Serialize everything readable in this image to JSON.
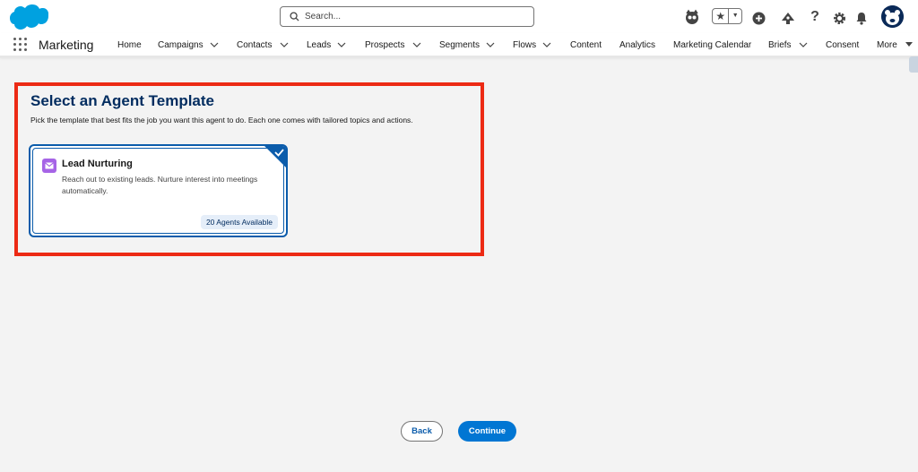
{
  "header": {
    "search_placeholder": "Search...",
    "brand_color": "#00a1e0"
  },
  "nav": {
    "app_name": "Marketing",
    "items": [
      {
        "label": "Home"
      },
      {
        "label": "Campaigns"
      },
      {
        "label": "Contacts"
      },
      {
        "label": "Leads"
      },
      {
        "label": "Prospects"
      },
      {
        "label": "Segments"
      },
      {
        "label": "Flows"
      },
      {
        "label": "Content"
      },
      {
        "label": "Analytics"
      },
      {
        "label": "Marketing Calendar"
      },
      {
        "label": "Briefs"
      },
      {
        "label": "Consent"
      },
      {
        "label": "More"
      }
    ]
  },
  "main": {
    "title": "Select an Agent Template",
    "description": "Pick the template that best fits the job you want this agent to do. Each one comes with tailored topics and actions.",
    "template_card": {
      "icon": "envelope-icon",
      "title": "Lead Nurturing",
      "description": "Reach out to existing leads. Nurture interest into meetings automatically.",
      "badge": "20 Agents Available",
      "selected": true
    }
  },
  "footer": {
    "back_label": "Back",
    "continue_label": "Continue"
  },
  "colors": {
    "highlight_border": "#ec2a14",
    "title": "#032d60",
    "primary_button": "#0176d3",
    "selected_border": "#0b5cab"
  }
}
